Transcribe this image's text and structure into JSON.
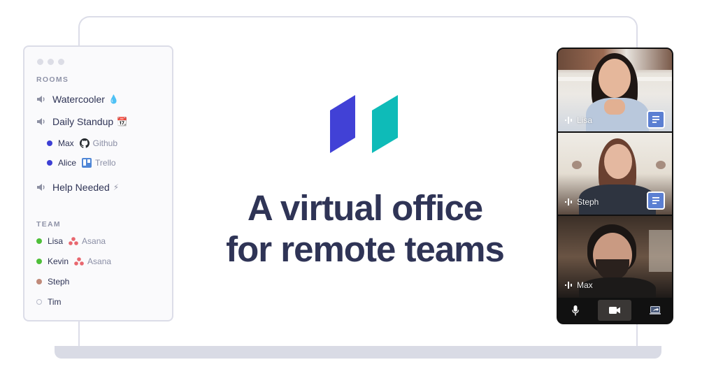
{
  "sidebar": {
    "rooms_label": "ROOMS",
    "rooms": [
      {
        "name": "Watercooler",
        "emoji": "💧",
        "icon": "speaker-icon"
      },
      {
        "name": "Daily Standup",
        "emoji": "📆",
        "icon": "speaker-icon",
        "members": [
          {
            "name": "Max",
            "app": "Github",
            "app_icon": "github-icon",
            "status_color": "#3d3fd4"
          },
          {
            "name": "Alice",
            "app": "Trello",
            "app_icon": "trello-icon",
            "status_color": "#3d3fd4"
          }
        ]
      },
      {
        "name": "Help Needed",
        "emoji": "⚡",
        "icon": "speaker-icon"
      }
    ],
    "team_label": "TEAM",
    "team": [
      {
        "name": "Lisa",
        "app": "Asana",
        "app_icon": "asana-icon",
        "status": "online",
        "status_color": "#4fbf3a"
      },
      {
        "name": "Kevin",
        "app": "Asana",
        "app_icon": "asana-icon",
        "status": "online",
        "status_color": "#4fbf3a"
      },
      {
        "name": "Steph",
        "status": "away",
        "status_color": "#c08a7a"
      },
      {
        "name": "Tim",
        "status": "offline",
        "status_color": "#b8bbc9"
      }
    ]
  },
  "logo": {
    "left_color": "#4141d6",
    "right_color": "#0ebbb8"
  },
  "headline": {
    "line1": "A virtual office",
    "line2": "for remote teams"
  },
  "call": {
    "participants": [
      {
        "name": "Lisa",
        "has_doc": true
      },
      {
        "name": "Steph",
        "has_doc": true
      },
      {
        "name": "Max",
        "has_doc": false
      }
    ],
    "controls": [
      "microphone-icon",
      "video-camera-icon",
      "screen-share-icon"
    ]
  }
}
